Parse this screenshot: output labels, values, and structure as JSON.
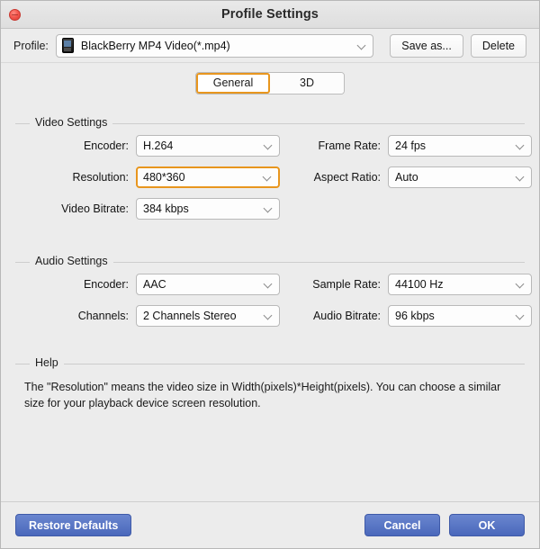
{
  "window": {
    "title": "Profile Settings",
    "close_icon": "close-icon"
  },
  "profile": {
    "label": "Profile:",
    "device_icon": "blackberry-device-icon",
    "value": "BlackBerry MP4 Video(*.mp4)",
    "dropdown_icon": "chevron-down-icon",
    "save_as_label": "Save as...",
    "delete_label": "Delete"
  },
  "tabs": [
    {
      "label": "General",
      "active": true
    },
    {
      "label": "3D",
      "active": false
    }
  ],
  "video_settings": {
    "title": "Video Settings",
    "fields": [
      {
        "label": "Encoder:",
        "value": "H.264",
        "focused": false
      },
      {
        "label": "Frame Rate:",
        "value": "24 fps",
        "focused": false
      },
      {
        "label": "Resolution:",
        "value": "480*360",
        "focused": true
      },
      {
        "label": "Aspect Ratio:",
        "value": "Auto",
        "focused": false
      },
      {
        "label": "Video Bitrate:",
        "value": "384 kbps",
        "focused": false
      }
    ]
  },
  "audio_settings": {
    "title": "Audio Settings",
    "fields": [
      {
        "label": "Encoder:",
        "value": "AAC",
        "focused": false
      },
      {
        "label": "Sample Rate:",
        "value": "44100 Hz",
        "focused": false
      },
      {
        "label": "Channels:",
        "value": "2 Channels Stereo",
        "focused": false
      },
      {
        "label": "Audio Bitrate:",
        "value": "96 kbps",
        "focused": false
      }
    ]
  },
  "help": {
    "title": "Help",
    "text": "The \"Resolution\" means the video size in Width(pixels)*Height(pixels).  You can choose a similar size for your playback device screen resolution."
  },
  "footer": {
    "restore_defaults_label": "Restore Defaults",
    "cancel_label": "Cancel",
    "ok_label": "OK"
  },
  "colors": {
    "accent_orange": "#e8961e",
    "button_blue": "#4a68bb",
    "window_background": "#ececec",
    "field_background": "#fdfdfd"
  }
}
